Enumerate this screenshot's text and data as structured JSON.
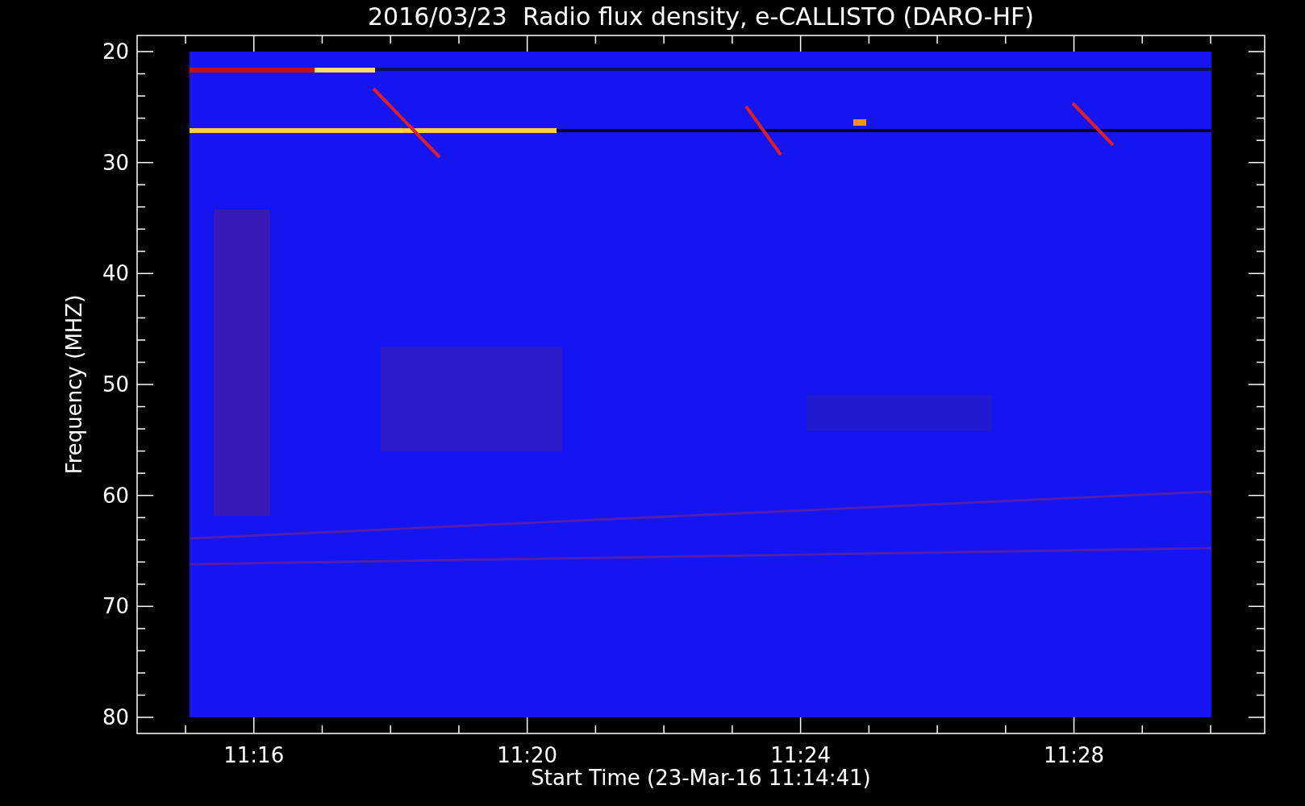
{
  "title": "2016/03/23  Radio flux density, e-CALLISTO (DARO-HF)",
  "y_axis": {
    "label": "Frequency (MHZ)",
    "ticks": [
      "20",
      "30",
      "40",
      "50",
      "60",
      "70",
      "80"
    ]
  },
  "x_axis": {
    "label": "Start Time (23-Mar-16 11:14:41)",
    "ticks": [
      "11:16",
      "11:20",
      "11:24",
      "11:28"
    ]
  }
}
